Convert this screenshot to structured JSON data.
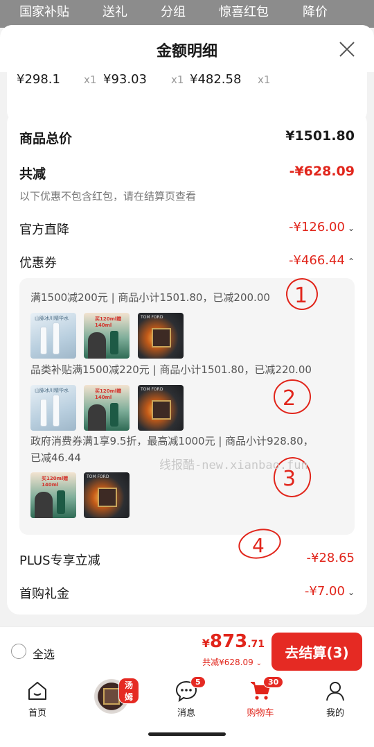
{
  "top_tabs": [
    "国家补贴",
    "送礼",
    "分组",
    "惊喜红包",
    "降价"
  ],
  "sheet": {
    "title": "金额明细"
  },
  "items_prices": [
    {
      "price": "¥298.1",
      "qty": "x1"
    },
    {
      "price": "¥93.03",
      "qty": "x1"
    },
    {
      "price": "¥482.58",
      "qty": "x1"
    }
  ],
  "summary": {
    "goods_total_label": "商品总价",
    "goods_total_value": "¥1501.80",
    "total_discount_label": "共减",
    "total_discount_value": "-¥628.09",
    "note": "以下优惠不包含红包，请在结算页查看",
    "official_drop_label": "官方直降",
    "official_drop_value": "-¥126.00",
    "coupon_label": "优惠券",
    "coupon_value": "-¥466.44",
    "plus_label": "PLUS专享立减",
    "plus_value": "-¥28.65",
    "first_buy_label": "首购礼金",
    "first_buy_value": "-¥7.00"
  },
  "coupons": [
    {
      "text": "满1500减200元 | 商品小计1501.80，已减200.00",
      "thumbs": [
        "a",
        "b",
        "c"
      ]
    },
    {
      "text": "品类补贴满1500减220元 | 商品小计1501.80，已减220.00",
      "thumbs": [
        "a",
        "b",
        "c"
      ]
    },
    {
      "text_line1": "政府消费券满1享9.5折，最高减1000元 | 商品小计928.80，",
      "text_line2": "已减46.44",
      "thumbs": [
        "b",
        "c"
      ]
    }
  ],
  "thumb_text": {
    "a_label": "山脉冰川精华水",
    "b_tag": "买120ml赠140ml",
    "c_brand": "TOM FORD"
  },
  "watermark": "线报酷-new.xianbao.fun",
  "annotations": [
    "1",
    "2",
    "3",
    "4"
  ],
  "bottom": {
    "select_all": "全选",
    "total_symbol": "¥",
    "total_int": "873",
    "total_dec": ".71",
    "total_sub": "共减¥628.09",
    "checkout": "去结算(3)"
  },
  "nav": {
    "home": "首页",
    "store_badge": "汤姆",
    "messages": "消息",
    "messages_badge": "5",
    "cart": "购物车",
    "cart_badge": "30",
    "mine": "我的"
  },
  "colors": {
    "accent": "#e1251b",
    "checkout_bg": "#e52a23"
  }
}
